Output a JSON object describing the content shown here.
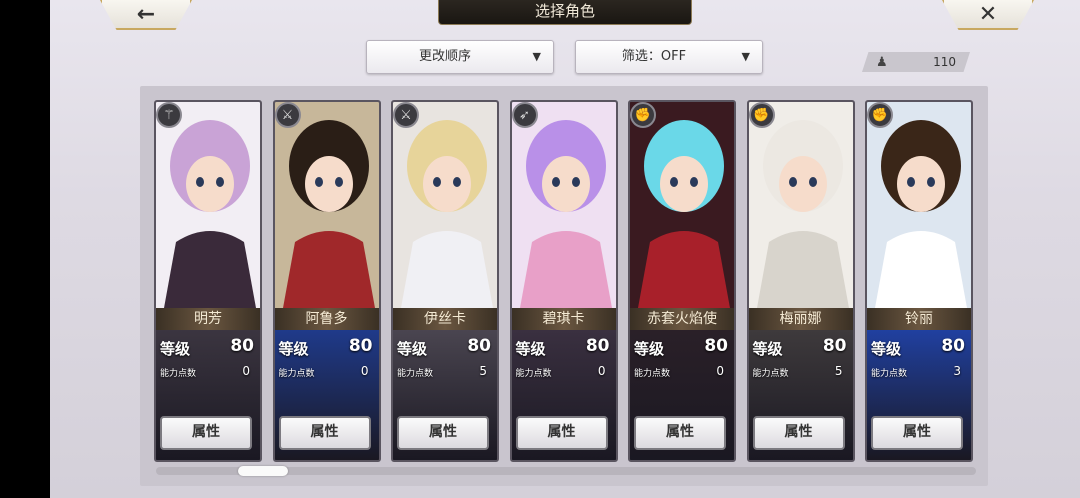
{
  "header": {
    "title": "选择角色",
    "back_icon": "←",
    "close_icon": "✕"
  },
  "toolbar": {
    "sort_label": "更改顺序",
    "filter_label": "筛选：OFF",
    "dropdown_arrow": "▼",
    "count_icon": "person-icon",
    "count_value": "110"
  },
  "labels": {
    "level": "等级",
    "points": "能力点数",
    "attribute_button": "属性"
  },
  "characters": [
    {
      "name": "明芳",
      "level": "80",
      "points": "0",
      "weapon_icon": "staff-icon",
      "hair": "#c9a3d6",
      "outfit": "#3a2a3a",
      "bg": "#f2eef4",
      "info_bg": "#3b3540"
    },
    {
      "name": "阿鲁多",
      "level": "80",
      "points": "0",
      "weapon_icon": "sword-icon",
      "hair": "#2a1e16",
      "outfit": "#a0282a",
      "bg": "#c7b79a",
      "info_bg": "#1f3a8a"
    },
    {
      "name": "伊丝卡",
      "level": "80",
      "points": "5",
      "weapon_icon": "sword-icon",
      "hair": "#e7d49a",
      "outfit": "#f0f0f4",
      "bg": "#e8e4e0",
      "info_bg": "#4a4550"
    },
    {
      "name": "碧琪卡",
      "level": "80",
      "points": "0",
      "weapon_icon": "bow-icon",
      "hair": "#b990e8",
      "outfit": "#e8a0c8",
      "bg": "#efe0f2",
      "info_bg": "#3a3040"
    },
    {
      "name": "赤套火焰使",
      "level": "80",
      "points": "0",
      "weapon_icon": "fist-icon",
      "hair": "#6ad8e8",
      "outfit": "#a8202a",
      "bg": "#3a1a20",
      "info_bg": "#2a2028"
    },
    {
      "name": "梅丽娜",
      "level": "80",
      "points": "5",
      "weapon_icon": "fist-icon",
      "hair": "#ece8e2",
      "outfit": "#d8d4cc",
      "bg": "#f0ede8",
      "info_bg": "#3e3a3c"
    },
    {
      "name": "铃丽",
      "level": "80",
      "points": "3",
      "weapon_icon": "fist-icon",
      "hair": "#3a2618",
      "outfit": "#ffffff",
      "bg": "#dde6f0",
      "info_bg": "#2040a0"
    }
  ]
}
